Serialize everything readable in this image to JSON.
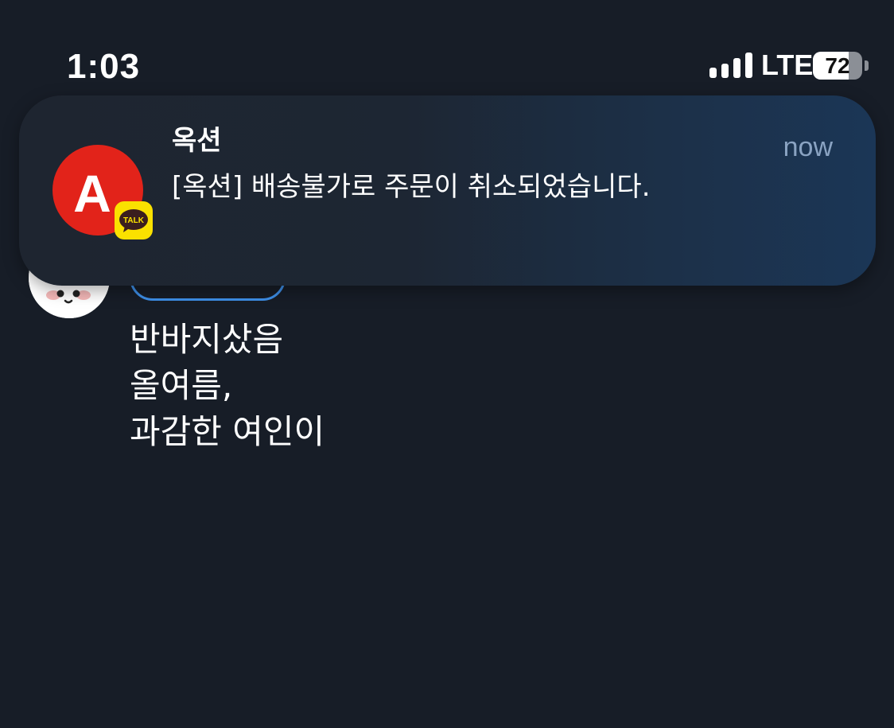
{
  "status_bar": {
    "time": "1:03",
    "network": "LTE",
    "battery_level": "72",
    "signal_icon": "cellular-signal-icon",
    "battery_icon": "battery-icon"
  },
  "notification": {
    "app_name": "옥션",
    "time": "now",
    "message": "[옥션] 배송불가로 주문이 취소되었습니다.",
    "app_icon": "auction-app-icon",
    "badge_icon": "kakaotalk-badge-icon",
    "badge_text": "TALK",
    "icon_letter": "A"
  },
  "post": {
    "lines": [
      "반바지샀음",
      "올여름,",
      "과감한 여인이"
    ]
  },
  "colors": {
    "background": "#171d27",
    "auction_red": "#e2231a",
    "kakao_yellow": "#fae100",
    "chip_blue": "#3d8fe8",
    "time_text": "#8aa3c2"
  }
}
